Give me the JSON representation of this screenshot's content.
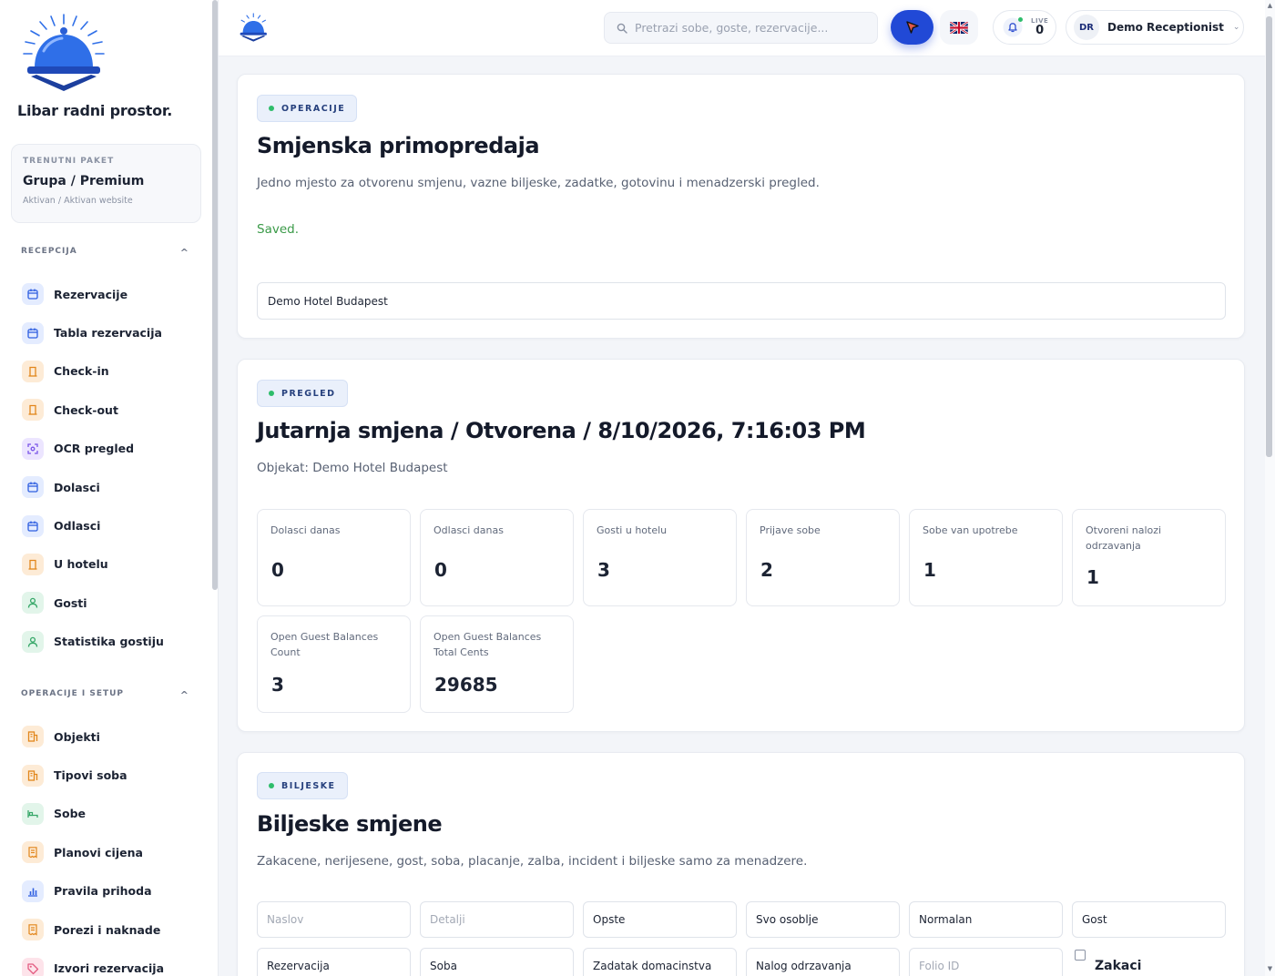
{
  "app": {
    "brand": "Libar radni prostor."
  },
  "plan": {
    "label": "TRENUTNI PAKET",
    "name": "Grupa / Premium",
    "status": "Aktivan / Aktivan website"
  },
  "sidebar": {
    "sections": [
      {
        "title": "RECEPCIJA",
        "chevron": "^",
        "items": [
          {
            "label": "Rezervacije",
            "icon": "calendar-icon",
            "color": "blue"
          },
          {
            "label": "Tabla rezervacija",
            "icon": "calendar-icon",
            "color": "blue"
          },
          {
            "label": "Check-in",
            "icon": "door-icon",
            "color": "orange"
          },
          {
            "label": "Check-out",
            "icon": "door-icon",
            "color": "orange"
          },
          {
            "label": "OCR pregled",
            "icon": "scan-icon",
            "color": "purple"
          },
          {
            "label": "Dolasci",
            "icon": "calendar-icon",
            "color": "blue"
          },
          {
            "label": "Odlasci",
            "icon": "calendar-icon",
            "color": "blue"
          },
          {
            "label": "U hotelu",
            "icon": "door-icon",
            "color": "orange"
          },
          {
            "label": "Gosti",
            "icon": "user-icon",
            "color": "green"
          },
          {
            "label": "Statistika gostiju",
            "icon": "user-icon",
            "color": "green"
          }
        ]
      },
      {
        "title": "OPERACIJE I SETUP",
        "chevron": "^",
        "items": [
          {
            "label": "Objekti",
            "icon": "building-icon",
            "color": "orange"
          },
          {
            "label": "Tipovi soba",
            "icon": "building-icon",
            "color": "orange"
          },
          {
            "label": "Sobe",
            "icon": "bed-icon",
            "color": "green"
          },
          {
            "label": "Planovi cijena",
            "icon": "receipt-icon",
            "color": "orange"
          },
          {
            "label": "Pravila prihoda",
            "icon": "chart-icon",
            "color": "blue"
          },
          {
            "label": "Porezi i naknade",
            "icon": "receipt-icon",
            "color": "orange"
          },
          {
            "label": "Izvori rezervacija",
            "icon": "tag-icon",
            "color": "pink"
          }
        ]
      }
    ]
  },
  "topbar": {
    "search_placeholder": "Pretrazi sobe, goste, rezervacije...",
    "live_label": "LIVE",
    "live_count": "0",
    "user_initials": "DR",
    "user_name": "Demo Receptionist",
    "language_flag": "uk-flag-icon"
  },
  "colors": {
    "accent": "#2149d6",
    "success": "#3a9a48",
    "status_dot": "#2ebd6b"
  },
  "handover": {
    "tag": "OPERACIJE",
    "title": "Smjenska primopredaja",
    "description": "Jedno mjesto za otvorenu smjenu, vazne biljeske, zadatke, gotovinu i menadzerski pregled.",
    "saved_message": "Saved.",
    "hotel_value": "Demo Hotel Budapest"
  },
  "overview": {
    "tag": "PREGLED",
    "title": "Jutarnja smjena / Otvorena / 8/10/2026, 7:16:03 PM",
    "property": "Objekat: Demo Hotel Budapest",
    "stats": [
      {
        "label": "Dolasci danas",
        "value": "0"
      },
      {
        "label": "Odlasci danas",
        "value": "0"
      },
      {
        "label": "Gosti u hotelu",
        "value": "3"
      },
      {
        "label": "Prijave sobe",
        "value": "2"
      },
      {
        "label": "Sobe van upotrebe",
        "value": "1"
      },
      {
        "label": "Otvoreni nalozi odrzavanja",
        "value": "1"
      },
      {
        "label": "Open Guest Balances Count",
        "value": "3"
      },
      {
        "label": "Open Guest Balances Total Cents",
        "value": "29685"
      }
    ]
  },
  "notes": {
    "tag": "BILJESKE",
    "title": "Biljeske smjene",
    "description": "Zakacene, nerijesene, gost, soba, placanje, zalba, incident i biljeske samo za menadzere.",
    "fields": {
      "title_placeholder": "Naslov",
      "details_placeholder": "Detalji",
      "category": "Opste",
      "audience": "Svo osoblje",
      "priority": "Normalan",
      "guest": "Gost",
      "reservation": "Rezervacija",
      "room": "Soba",
      "housekeeping_task": "Zadatak domacinstva",
      "maintenance_order": "Nalog odrzavanja",
      "folio_placeholder": "Folio ID",
      "pin_label": "Zakaci"
    }
  }
}
